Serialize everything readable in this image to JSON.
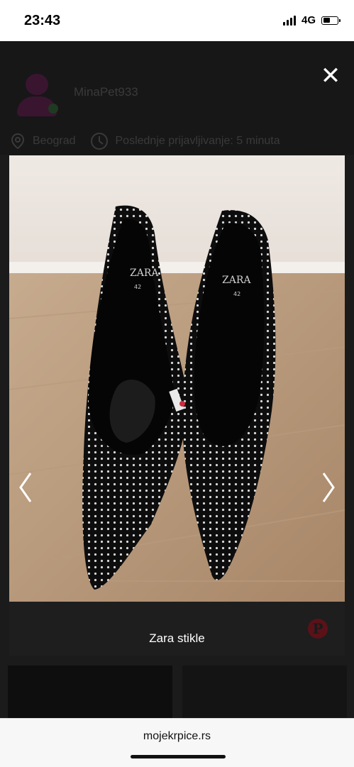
{
  "status_bar": {
    "time": "23:43",
    "network": "4G",
    "battery_level": 0.55
  },
  "seller": {
    "username": "MinaPet933",
    "location": "Beograd",
    "last_login": "Poslednje prijavljivanje: 5 minuta"
  },
  "listing": {
    "caption": "Zara stikle"
  },
  "icons": {
    "close": "close-icon",
    "location": "location-pin-icon",
    "clock": "clock-icon",
    "prev": "chevron-left-icon",
    "next": "chevron-right-icon",
    "pinterest": "pinterest-icon"
  },
  "browser": {
    "url": "mojekrpice.rs"
  },
  "colors": {
    "overlay": "#1b1b1b",
    "avatar": "#3a1530",
    "pinterest": "#5a1218"
  }
}
